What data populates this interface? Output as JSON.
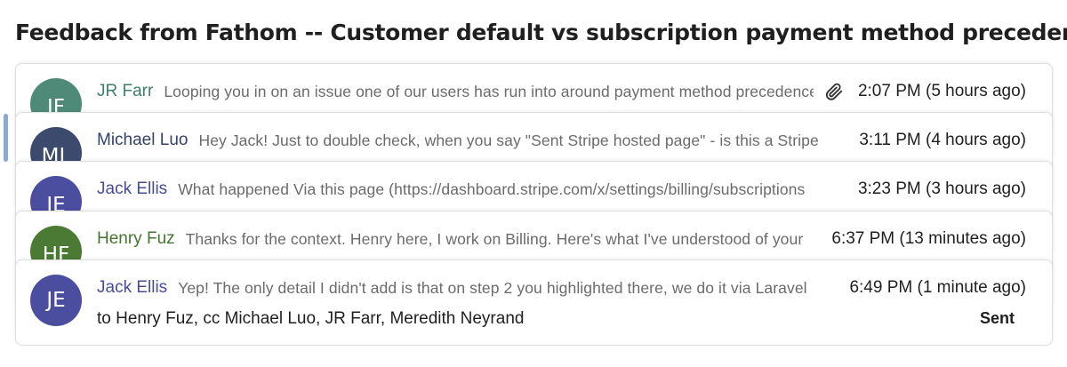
{
  "thread": {
    "title": "Feedback from Fathom -- Customer default vs subscription payment method precedence"
  },
  "messages": [
    {
      "initials": "JF",
      "avatar_color": "#4f8a78",
      "sender": "JR Farr",
      "sender_color": "#3f7f6a",
      "snippet": "Looping you in on an issue one of our users has run into around payment method precedence",
      "time": "2:07 PM (5 hours ago)",
      "has_attachment": true,
      "attachment_icon": "paperclip-icon"
    },
    {
      "initials": "ML",
      "avatar_color": "#3c4a6e",
      "sender": "Michael Luo",
      "sender_color": "#34436a",
      "snippet": "Hey Jack! Just to double check, when you say \"Sent Stripe hosted page\" - is this a Stripe",
      "time": "3:11 PM (4 hours ago)",
      "has_attachment": false
    },
    {
      "initials": "JE",
      "avatar_color": "#4b4e9e",
      "sender": "Jack Ellis",
      "sender_color": "#484c98",
      "snippet": "What happened Via this page (https://dashboard.stripe.com/x/settings/billing/subscriptions",
      "time": "3:23 PM (3 hours ago)",
      "has_attachment": false
    },
    {
      "initials": "HF",
      "avatar_color": "#4a7a33",
      "sender": "Henry Fuz",
      "sender_color": "#44742f",
      "snippet": "Thanks for the context. Henry here, I work on Billing. Here's what I've understood of your",
      "time": "6:37 PM (13 minutes ago)",
      "has_attachment": false
    },
    {
      "initials": "JE",
      "avatar_color": "#4b4e9e",
      "sender": "Jack Ellis",
      "sender_color": "#484c98",
      "snippet": "Yep! The only detail I didn't add is that on step 2 you highlighted there, we do it via Laravel",
      "time": "6:49 PM (1 minute ago)",
      "has_attachment": false,
      "recipients": "to Henry Fuz, cc Michael Luo, JR Farr, Meredith Neyrand",
      "status": "Sent"
    }
  ]
}
